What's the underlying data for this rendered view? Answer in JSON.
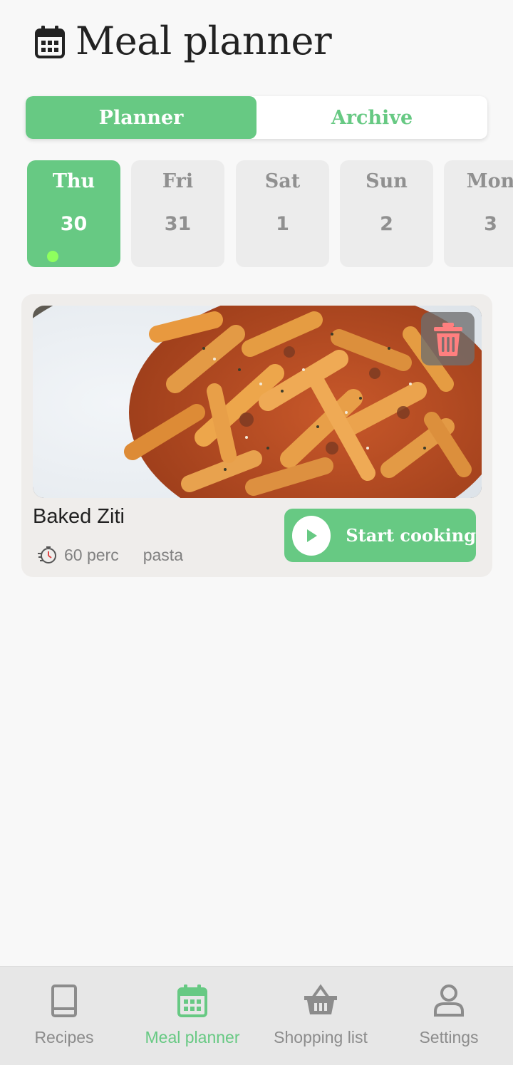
{
  "header": {
    "title": "Meal planner",
    "icon": "calendar-icon"
  },
  "tabs": [
    {
      "label": "Planner",
      "active": true
    },
    {
      "label": "Archive",
      "active": false
    }
  ],
  "days": [
    {
      "day": "Thu",
      "date": "30",
      "active": true,
      "has_meal": true
    },
    {
      "day": "Fri",
      "date": "31",
      "active": false,
      "has_meal": false
    },
    {
      "day": "Sat",
      "date": "1",
      "active": false,
      "has_meal": false
    },
    {
      "day": "Sun",
      "date": "2",
      "active": false,
      "has_meal": false
    },
    {
      "day": "Mon",
      "date": "3",
      "active": false,
      "has_meal": false
    }
  ],
  "meal": {
    "title": "Baked Ziti",
    "time": "60 perc",
    "category": "pasta",
    "start_label": "Start cooking",
    "image": "pasta-dish-photo",
    "delete_icon": "trash-icon",
    "start_icon": "play-icon",
    "time_icon": "timer-icon"
  },
  "nav": {
    "items": [
      {
        "label": "Recipes",
        "icon": "book-icon",
        "active": false
      },
      {
        "label": "Meal planner",
        "icon": "calendar-icon",
        "active": true
      },
      {
        "label": "Shopping list",
        "icon": "basket-icon",
        "active": false
      },
      {
        "label": "Settings",
        "icon": "person-icon",
        "active": false
      }
    ]
  },
  "colors": {
    "accent": "#67c983",
    "delete": "#ff7f7f",
    "active_dot": "#8fff5e",
    "muted_text": "#909090"
  }
}
